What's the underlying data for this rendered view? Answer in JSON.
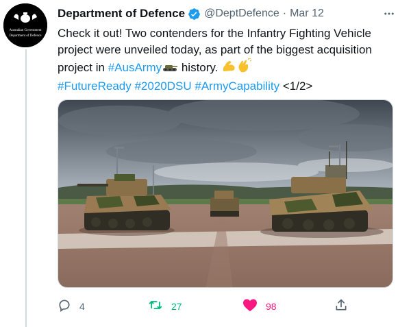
{
  "account": {
    "display_name": "Department of Defence",
    "handle": "@DeptDefence",
    "separator": "·",
    "date": "Mar 12",
    "verified": true,
    "avatar_text_line1": "Australian Government",
    "avatar_text_line2": "Department of Defence"
  },
  "tweet": {
    "text_part1": "Check it out! Two contenders for the Infantry Fighting Vehicle project were unveiled today, as part of the biggest acquisition project in ",
    "hashtag_ausarmy": "#AusArmy",
    "text_part2": " history. ",
    "hashtag_futureready": "#FutureReady",
    "hashtag_2020dsu": "#2020DSU",
    "hashtag_armycapability": "#ArmyCapability",
    "thread_marker": "<1/2>"
  },
  "media": {
    "description_icon": "photo"
  },
  "actions": {
    "reply_count": "4",
    "retweet_count": "27",
    "like_count": "98",
    "liked": true,
    "retweeted": true
  },
  "colors": {
    "accent": "#1d9bf0",
    "retweet": "#00ba7c",
    "like": "#f91880",
    "muted": "#536471"
  }
}
